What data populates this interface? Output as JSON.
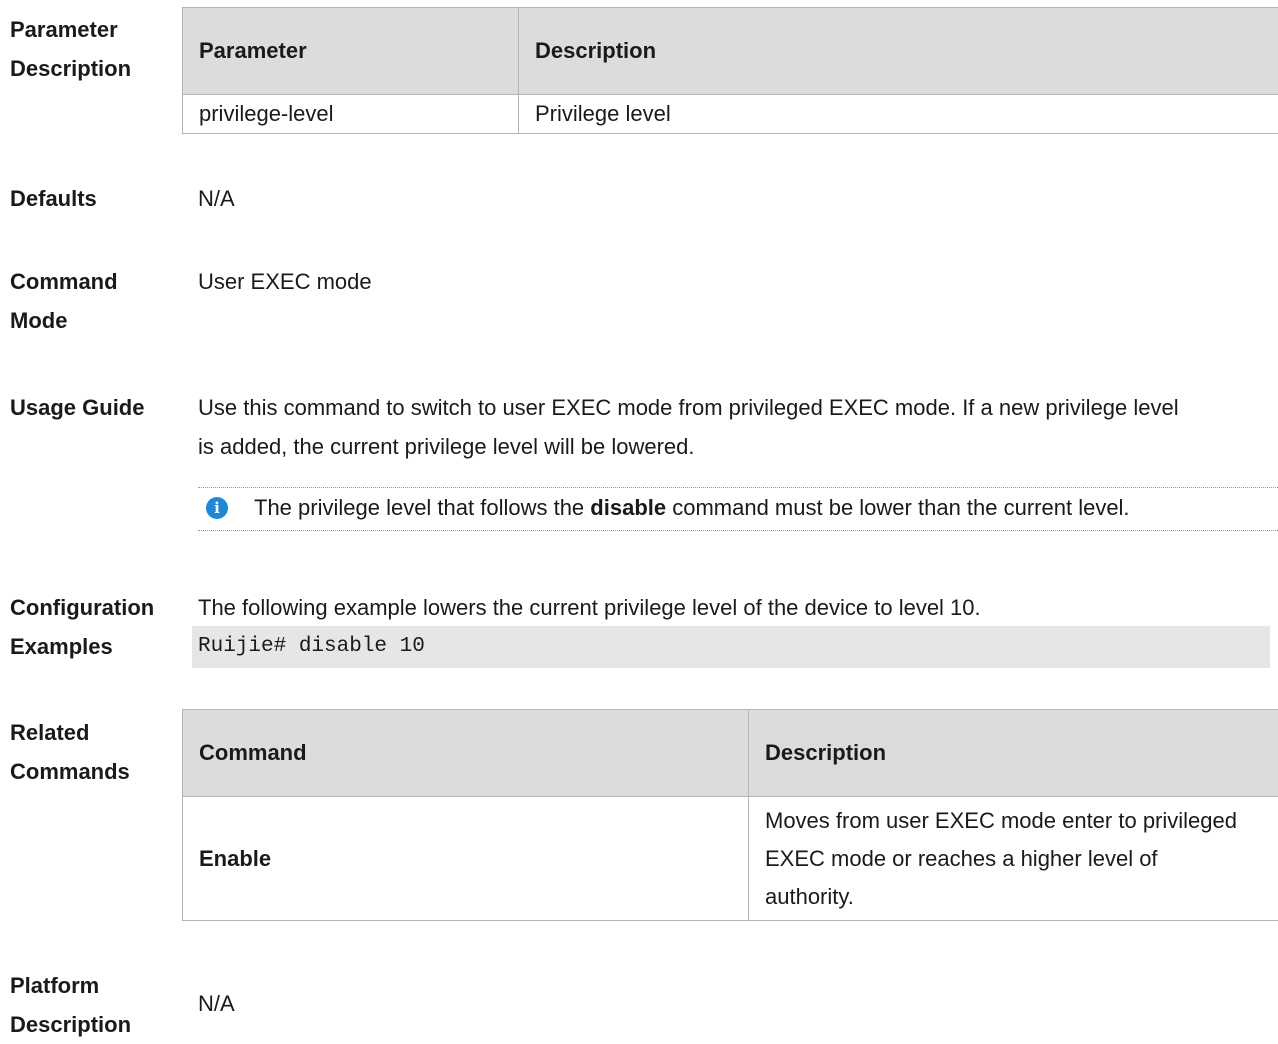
{
  "parameter_description": {
    "label_line1": "Parameter",
    "label_line2": "Description",
    "table": {
      "headers": [
        "Parameter",
        "Description"
      ],
      "rows": [
        [
          "privilege-level",
          "Privilege level"
        ]
      ]
    }
  },
  "defaults": {
    "label": "Defaults",
    "value": "N/A"
  },
  "command_mode": {
    "label_line1": "Command",
    "label_line2": "Mode",
    "value": "User EXEC mode"
  },
  "usage_guide": {
    "label": "Usage Guide",
    "line1": "Use this command to switch to user EXEC mode from privileged EXEC mode. If a new privilege level",
    "line2": "is added, the current privilege level will be lowered.",
    "note": {
      "icon": "info-icon",
      "before": "The privilege level that follows the ",
      "bold": "disable",
      "after": " command must be lower than the current level."
    }
  },
  "configuration_examples": {
    "label_line1": "Configuration",
    "label_line2": "Examples",
    "text": "The following example lowers the current privilege level of the device to level 10.",
    "code": "Ruijie# disable 10"
  },
  "related_commands": {
    "label_line1": "Related",
    "label_line2": "Commands",
    "table": {
      "headers": [
        "Command",
        "Description"
      ],
      "rows": [
        [
          "Enable",
          "Moves from user EXEC mode enter to privileged EXEC mode or reaches a higher level of authority."
        ]
      ]
    }
  },
  "platform_description": {
    "label_line1": "Platform",
    "label_line2": "Description",
    "value": "N/A"
  }
}
